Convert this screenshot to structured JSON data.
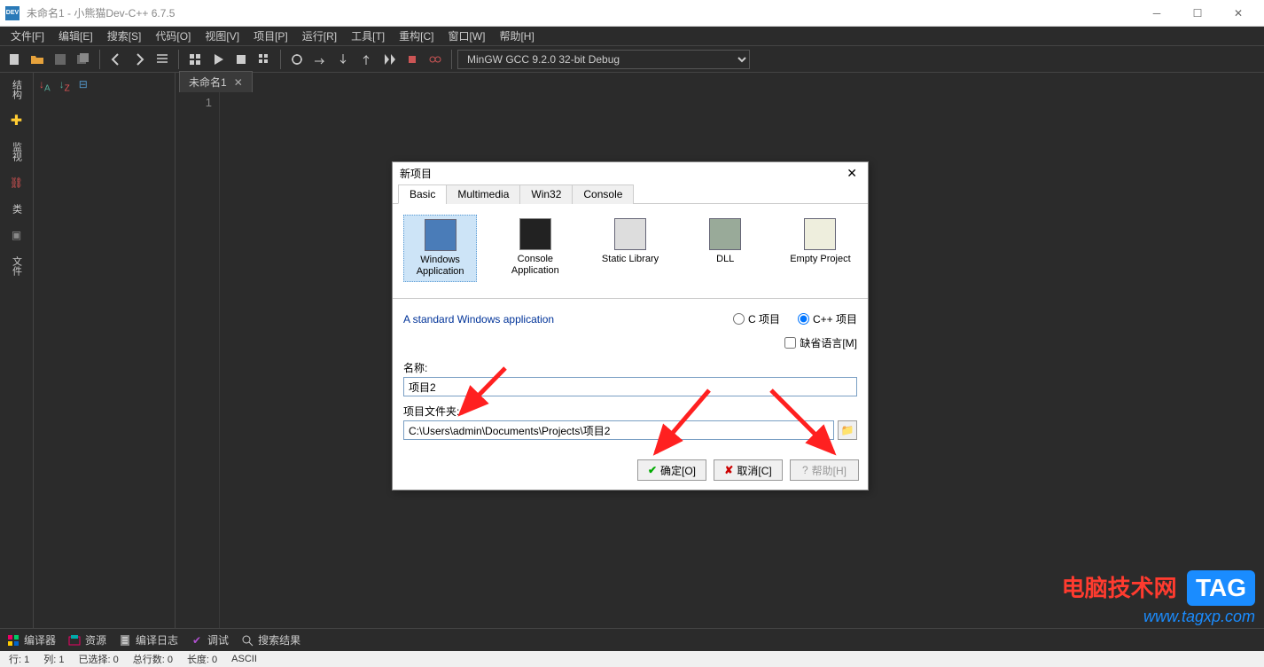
{
  "window": {
    "title": "未命名1 - 小熊猫Dev-C++ 6.7.5",
    "appicon_text": "DEV"
  },
  "menu": [
    "文件[F]",
    "编辑[E]",
    "搜索[S]",
    "代码[O]",
    "视图[V]",
    "项目[P]",
    "运行[R]",
    "工具[T]",
    "重构[C]",
    "窗口[W]",
    "帮助[H]"
  ],
  "compiler": {
    "selected": "MinGW GCC 9.2.0 32-bit Debug"
  },
  "leftstrip": {
    "tabs": [
      "结构",
      "监视",
      "类",
      "文件"
    ]
  },
  "tabs": {
    "file": "未命名1"
  },
  "gutter": {
    "line1": "1"
  },
  "bottom": [
    {
      "icon": "compiler",
      "label": "编译器"
    },
    {
      "icon": "resource",
      "label": "资源"
    },
    {
      "icon": "log",
      "label": "编译日志"
    },
    {
      "icon": "debug",
      "label": "调试"
    },
    {
      "icon": "search",
      "label": "搜索结果"
    }
  ],
  "status": {
    "line": "行:  1",
    "col": "列:  1",
    "sel": "已选择:  0",
    "total": "总行数:  0",
    "len": "长度:  0",
    "enc": "ASCII"
  },
  "dialog": {
    "title": "新项目",
    "tabs": [
      "Basic",
      "Multimedia",
      "Win32",
      "Console"
    ],
    "active_tab": 0,
    "types": [
      {
        "label": "Windows Application"
      },
      {
        "label": "Console Application"
      },
      {
        "label": "Static Library"
      },
      {
        "label": "DLL"
      },
      {
        "label": "Empty Project"
      }
    ],
    "desc": "A standard Windows application",
    "radio_c": "C 项目",
    "radio_cpp": "C++ 项目",
    "default_lang": "缺省语言[M]",
    "name_label": "名称:",
    "name_value": "项目2",
    "folder_label": "项目文件夹:",
    "folder_value": "C:\\Users\\admin\\Documents\\Projects\\项目2",
    "ok": "确定[O]",
    "cancel": "取消[C]",
    "help": "帮助[H]"
  },
  "watermark": {
    "l1": "电脑技术网",
    "tag": "TAG",
    "l2": "www.tagxp.com"
  }
}
